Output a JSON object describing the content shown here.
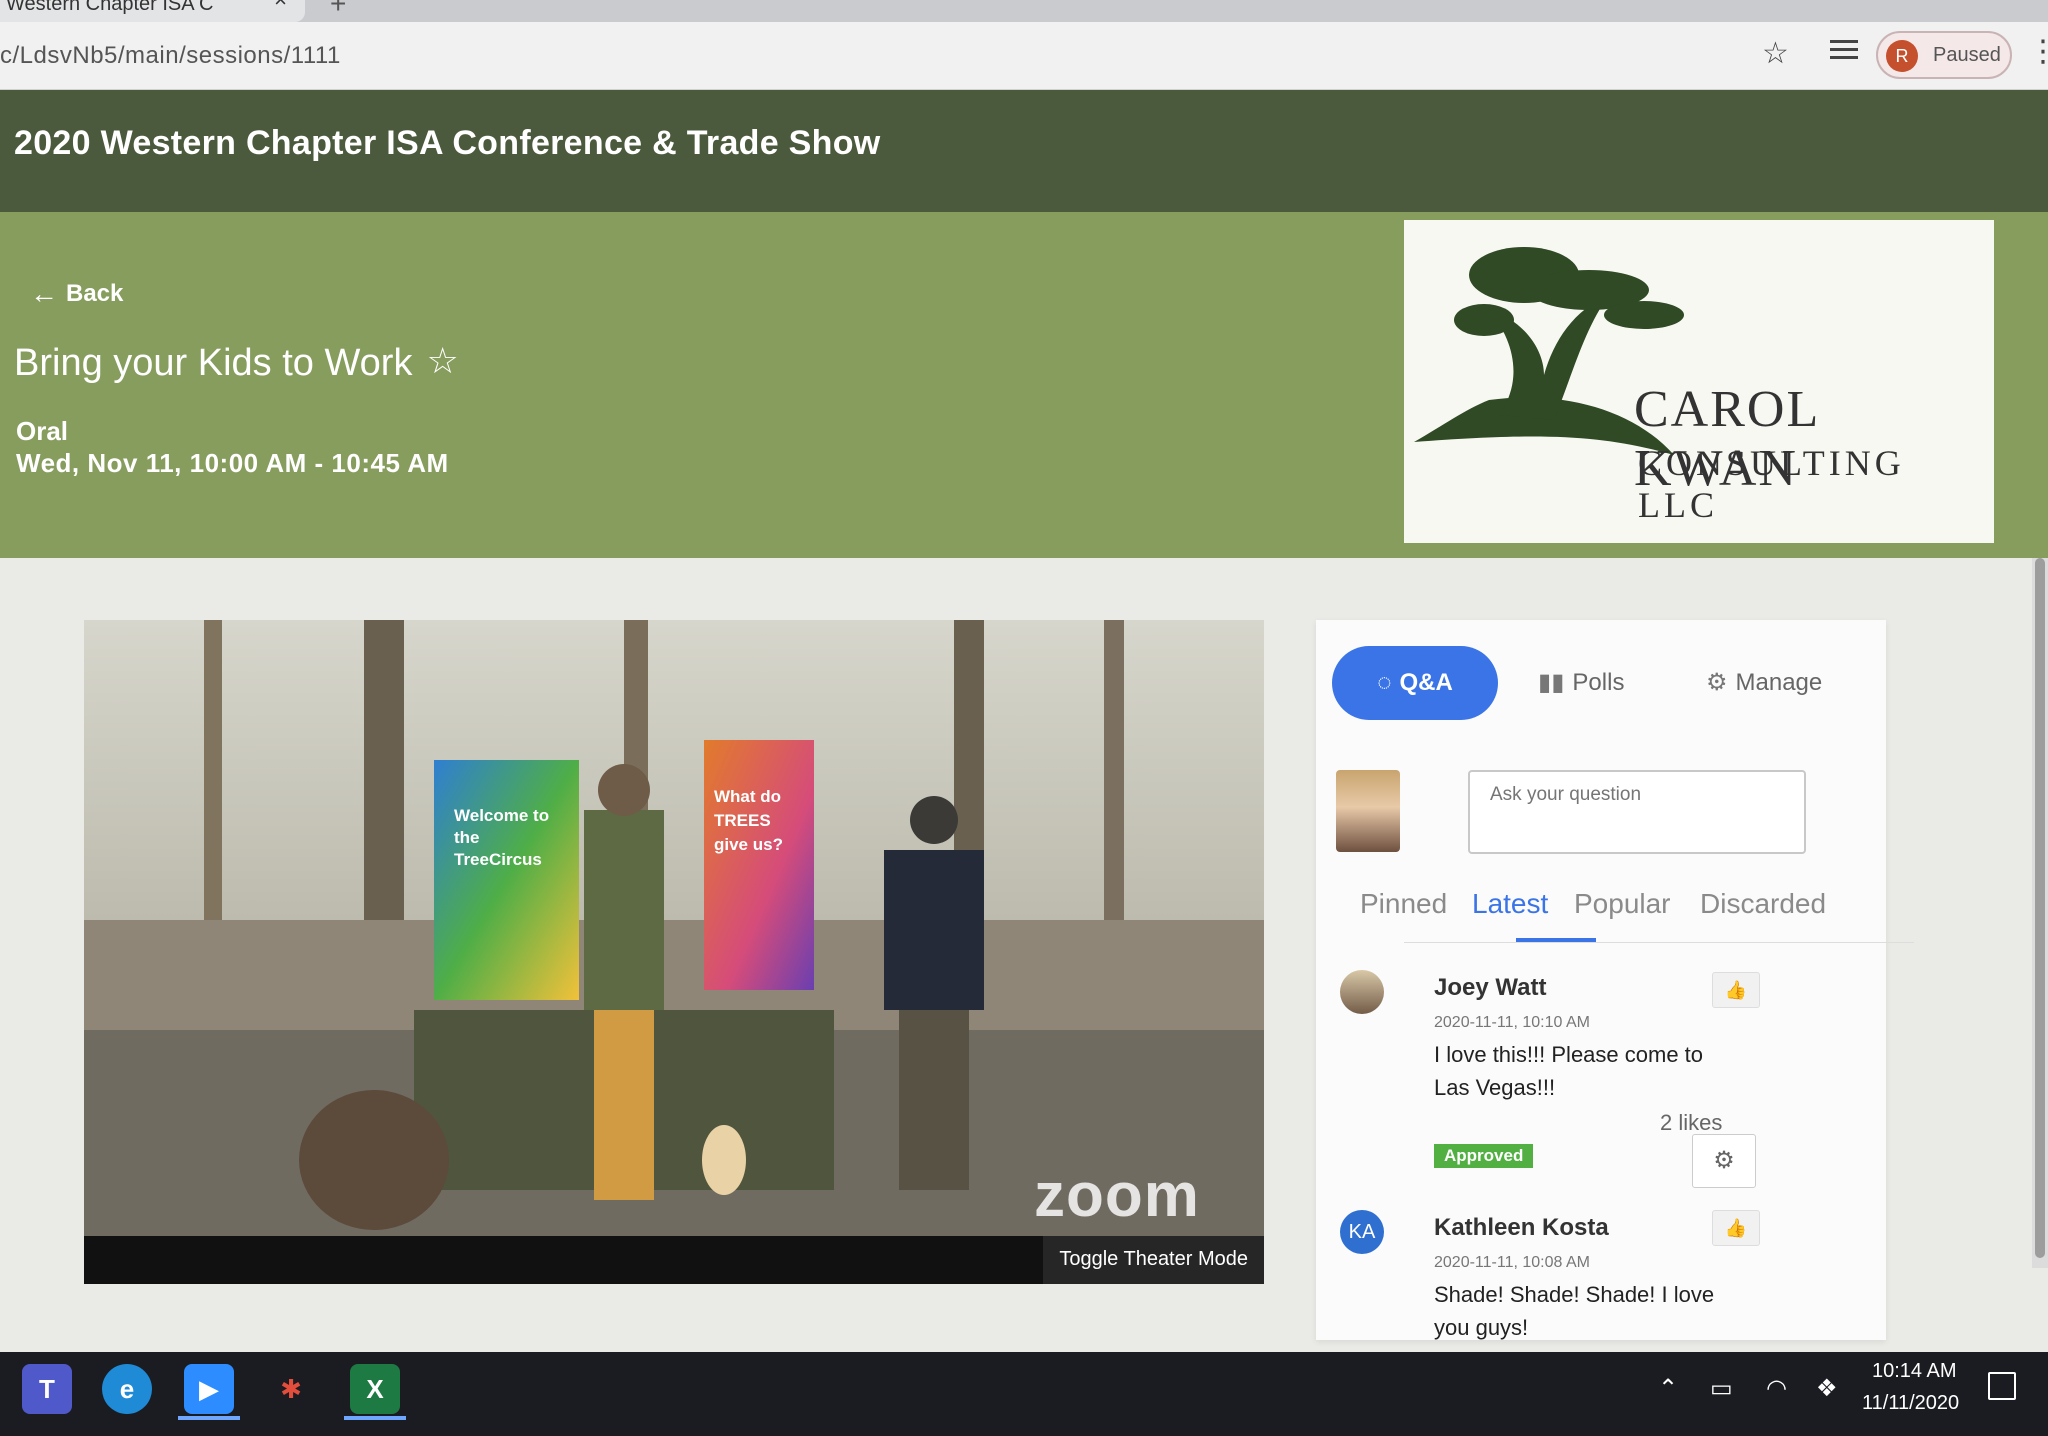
{
  "browser": {
    "tab_title": "Western Chapter ISA C",
    "url": "c/LdsvNb5/main/sessions/1111",
    "profile_initial": "R",
    "profile_status": "Paused"
  },
  "site": {
    "title": "2020 Western Chapter ISA Conference & Trade Show"
  },
  "session": {
    "back_label": "Back",
    "title": "Bring your Kids to Work",
    "type": "Oral",
    "time": "Wed, Nov 11, 10:00 AM - 10:45 AM",
    "sponsor_line1": "CAROL KWAN",
    "sponsor_line2": "CONSULTING LLC"
  },
  "video": {
    "toggle_label": "Toggle Theater Mode",
    "watermark": "zoom",
    "banner_left": "Welcome to the TreeCircus",
    "banner_right": "What do TREES give us?"
  },
  "panel": {
    "tabs": [
      {
        "label": "Q&A",
        "icon": "chat-icon"
      },
      {
        "label": "Polls",
        "icon": "bar-chart-icon"
      },
      {
        "label": "Manage",
        "icon": "gear-icon"
      }
    ],
    "question_placeholder": "Ask your question",
    "sort_tabs": [
      "Pinned",
      "Latest",
      "Popular",
      "Discarded"
    ],
    "active_sort": "Latest",
    "questions": [
      {
        "author": "Joey Watt",
        "date": "2020-11-11, 10:10 AM",
        "text": "I love this!!! Please come to Las Vegas!!!",
        "likes": "2 likes",
        "status": "Approved"
      },
      {
        "author": "Kathleen Kosta",
        "initials": "KA",
        "date": "2020-11-11, 10:08 AM",
        "text": "Shade! Shade! Shade! I love you guys!"
      }
    ]
  },
  "taskbar": {
    "time": "10:14 AM",
    "date": "11/11/2020",
    "apps": [
      "teams-icon",
      "edge-icon",
      "zoom-icon",
      "pinwheel-icon",
      "excel-icon"
    ]
  },
  "colors": {
    "header_bg": "#4b5a3d",
    "hero_bg": "#879d5e",
    "accent_blue": "#3a74e6",
    "approved_green": "#52b043"
  }
}
